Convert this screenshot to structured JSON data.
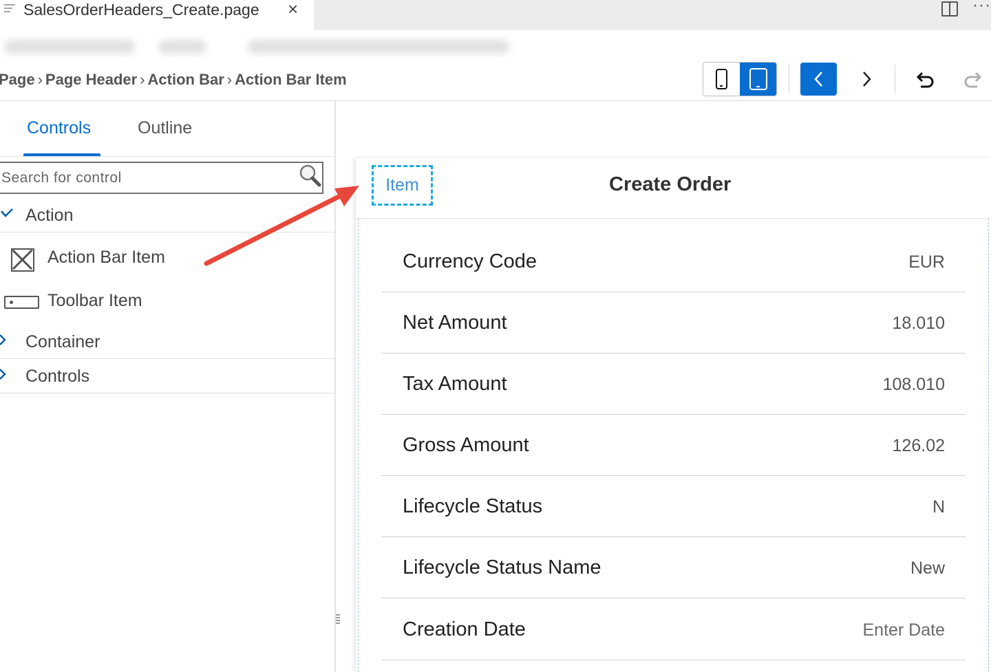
{
  "editor": {
    "tab_title": "SalesOrderHeaders_Create.page",
    "close_glyph": "×",
    "more_glyph": "···"
  },
  "breadcrumb": {
    "items": [
      "Page",
      "Page Header",
      "Action Bar",
      "Action Bar Item"
    ],
    "separator": "›"
  },
  "toolbar": {
    "phone_view": "phone-icon",
    "tablet_view": "tablet-icon",
    "active_view": "tablet",
    "back": "chevron-left-icon",
    "forward": "chevron-right-icon",
    "undo": "undo-icon",
    "redo": "redo-icon"
  },
  "left_panel": {
    "tabs": [
      {
        "label": "Controls",
        "active": true
      },
      {
        "label": "Outline",
        "active": false
      }
    ],
    "search": {
      "placeholder": "Search for control",
      "value": ""
    },
    "tree": {
      "action_group": {
        "label": "Action",
        "expanded": true
      },
      "action_bar_item": {
        "label": "Action Bar Item"
      },
      "toolbar_item": {
        "label": "Toolbar Item"
      },
      "container_group": {
        "label": "Container",
        "expanded": false
      },
      "controls_group": {
        "label": "Controls",
        "expanded": false
      }
    }
  },
  "preview": {
    "header": {
      "item_label": "Item",
      "title": "Create Order"
    },
    "fields": [
      {
        "label": "Currency Code",
        "value": "EUR",
        "placeholder": false
      },
      {
        "label": "Net Amount",
        "value": "18.010",
        "placeholder": false
      },
      {
        "label": "Tax Amount",
        "value": "108.010",
        "placeholder": false
      },
      {
        "label": "Gross Amount",
        "value": "126.02",
        "placeholder": false
      },
      {
        "label": "Lifecycle Status",
        "value": "N",
        "placeholder": false
      },
      {
        "label": "Lifecycle Status Name",
        "value": "New",
        "placeholder": false
      },
      {
        "label": "Creation Date",
        "value": "Enter Date",
        "placeholder": true
      }
    ]
  },
  "colors": {
    "accent": "#0a6ed1",
    "selection_outline": "#19a9e0",
    "annotation_arrow": "#e8483b"
  }
}
